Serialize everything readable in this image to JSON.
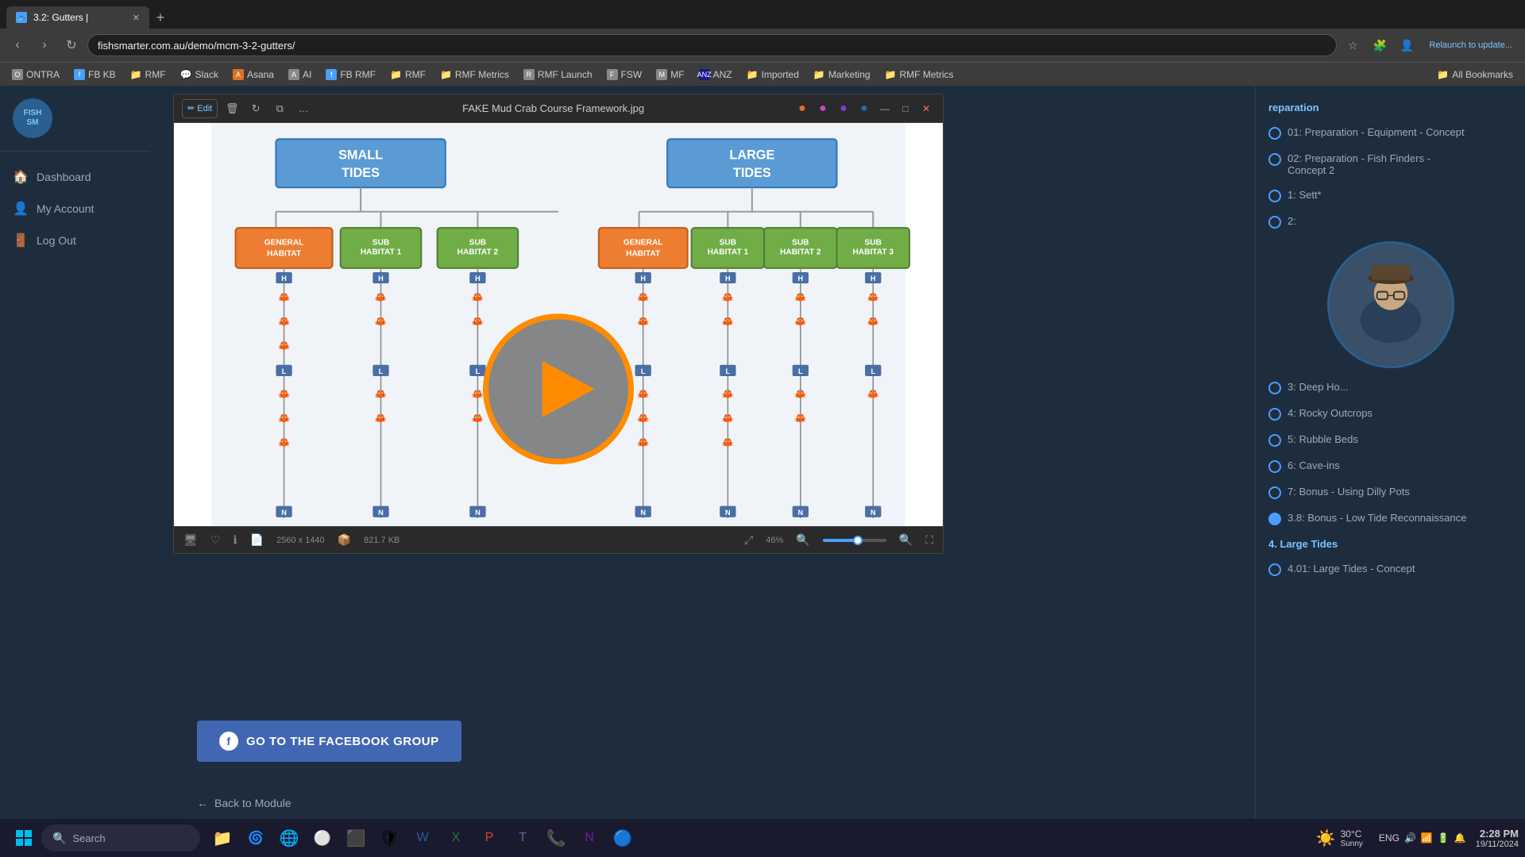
{
  "browser": {
    "tabs": [
      {
        "id": "tab1",
        "label": "3.2: Gutters |",
        "active": true,
        "favicon": "🐟"
      },
      {
        "id": "tab2",
        "label": "+",
        "is_new": true
      }
    ],
    "address": "fishsmarter.com.au/demo/mcm-3-2-gutters/",
    "bookmarks": [
      {
        "label": "ONTRA",
        "icon": "O",
        "type": "site"
      },
      {
        "label": "FB KB",
        "icon": "f",
        "type": "fb"
      },
      {
        "label": "RMF",
        "icon": "R",
        "type": "folder"
      },
      {
        "label": "Slack",
        "icon": "S",
        "type": "slack"
      },
      {
        "label": "Asana",
        "icon": "A",
        "type": "site"
      },
      {
        "label": "AI",
        "icon": "A",
        "type": "site"
      },
      {
        "label": "FB RMF",
        "icon": "f",
        "type": "fb"
      },
      {
        "label": "RMF",
        "icon": "R",
        "type": "site"
      },
      {
        "label": "RMF Metrics",
        "icon": "R",
        "type": "folder"
      },
      {
        "label": "RMF Launch",
        "icon": "R",
        "type": "site"
      },
      {
        "label": "FSW",
        "icon": "F",
        "type": "site"
      },
      {
        "label": "MF",
        "icon": "M",
        "type": "site"
      },
      {
        "label": "ANZ",
        "icon": "A",
        "type": "site"
      },
      {
        "label": "Imported",
        "icon": "📁",
        "type": "folder"
      },
      {
        "label": "Marketing",
        "icon": "📁",
        "type": "folder"
      },
      {
        "label": "RMF Metrics",
        "icon": "📁",
        "type": "folder"
      },
      {
        "label": "All Bookmarks",
        "icon": "📁",
        "type": "folder"
      }
    ]
  },
  "sidebar": {
    "logo_text": "FISHSM",
    "items": [
      {
        "label": "Dashboard",
        "icon": "🏠"
      },
      {
        "label": "My Account",
        "icon": "👤"
      },
      {
        "label": "Log Out",
        "icon": "🚪"
      }
    ]
  },
  "viewer": {
    "title": "FAKE Mud Crab Course Framework.jpg",
    "file_dimensions": "2560 x 1440",
    "file_size": "821.7 KB",
    "zoom": "46%",
    "tools": [
      "edit",
      "trash",
      "rotate",
      "copy",
      "more"
    ],
    "controls": [
      "minimize",
      "maximize",
      "close"
    ]
  },
  "diagram": {
    "title_left": "SMALL TIDES",
    "title_right": "LARGE TIDES",
    "boxes_left": [
      {
        "label": "GENERAL\nHABITAT",
        "color": "orange"
      },
      {
        "label": "SUB\nHABITAT 1",
        "color": "green"
      },
      {
        "label": "SUB\nHABITAT 2",
        "color": "green"
      }
    ],
    "boxes_right": [
      {
        "label": "GENERAL\nHABITAT",
        "color": "orange"
      },
      {
        "label": "SUB\nHABITAT 1",
        "color": "green"
      },
      {
        "label": "SUB\nHABITAT 2",
        "color": "green"
      },
      {
        "label": "SUB\nHABITAT 3",
        "color": "green"
      }
    ]
  },
  "right_panel": {
    "section_label": "reparation",
    "items": [
      {
        "label": "01: Preparation - Equipment - Concept",
        "state": "none"
      },
      {
        "label": "02: Preparation - Fish Finders - Concept 2",
        "state": "none"
      },
      {
        "label": "1: Sett*",
        "state": "none"
      },
      {
        "label": "2:",
        "state": "none"
      },
      {
        "label": "3: Deep Ho...",
        "state": "none"
      },
      {
        "label": "4: Rocky Outcrops",
        "state": "none"
      },
      {
        "label": "5: Rubble Beds",
        "state": "none"
      },
      {
        "label": "6: Cave-ins",
        "state": "none"
      },
      {
        "label": "7: Bonus - Using Dilly Pots",
        "state": "none"
      },
      {
        "label": "3.8: Bonus - Low Tide Reconnaissance",
        "state": "active"
      },
      {
        "label": "4. Large Tides",
        "state": "section"
      },
      {
        "label": "4.01: Large Tides - Concept",
        "state": "dot"
      }
    ]
  },
  "facebook_btn": {
    "label": "GO TO THE FACEBOOK GROUP",
    "icon": "f"
  },
  "back_btn": {
    "label": "Back to Module"
  },
  "taskbar": {
    "search_placeholder": "Search",
    "weather": "30°C",
    "weather_desc": "Sunny",
    "time": "2:28 PM",
    "date": "19/11/2024"
  }
}
